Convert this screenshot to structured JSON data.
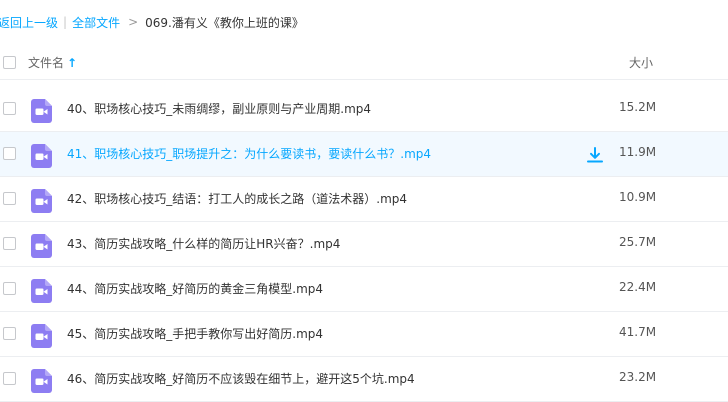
{
  "breadcrumb": {
    "back": "返回上一级",
    "all_files": "全部文件",
    "current": "069.潘有义《教你上班的课》",
    "separator": "|",
    "arrow": ">"
  },
  "header": {
    "name_label": "文件名",
    "size_label": "大小",
    "sort_icon": "arrow-up-icon"
  },
  "colors": {
    "accent": "#06a7ff",
    "hover_row": "#f2f9ff",
    "video_icon": "#8d7df2"
  },
  "files": [
    {
      "name": "40、职场核心技巧_未雨绸缪，副业原则与产业周期.mp4",
      "size": "15.2M",
      "icon": "video-file-icon"
    },
    {
      "name": "41、职场核心技巧_职场提升之：为什么要读书，要读什么书？.mp4",
      "size": "11.9M",
      "icon": "video-file-icon",
      "hover": true,
      "action_icon": "download-icon"
    },
    {
      "name": "42、职场核心技巧_结语：打工人的成长之路（道法术器）.mp4",
      "size": "10.9M",
      "icon": "video-file-icon"
    },
    {
      "name": "43、简历实战攻略_什么样的简历让HR兴奋？.mp4",
      "size": "25.7M",
      "icon": "video-file-icon"
    },
    {
      "name": "44、简历实战攻略_好简历的黄金三角模型.mp4",
      "size": "22.4M",
      "icon": "video-file-icon"
    },
    {
      "name": "45、简历实战攻略_手把手教你写出好简历.mp4",
      "size": "41.7M",
      "icon": "video-file-icon"
    },
    {
      "name": "46、简历实战攻略_好简历不应该毁在细节上，避开这5个坑.mp4",
      "size": "23.2M",
      "icon": "video-file-icon"
    }
  ]
}
